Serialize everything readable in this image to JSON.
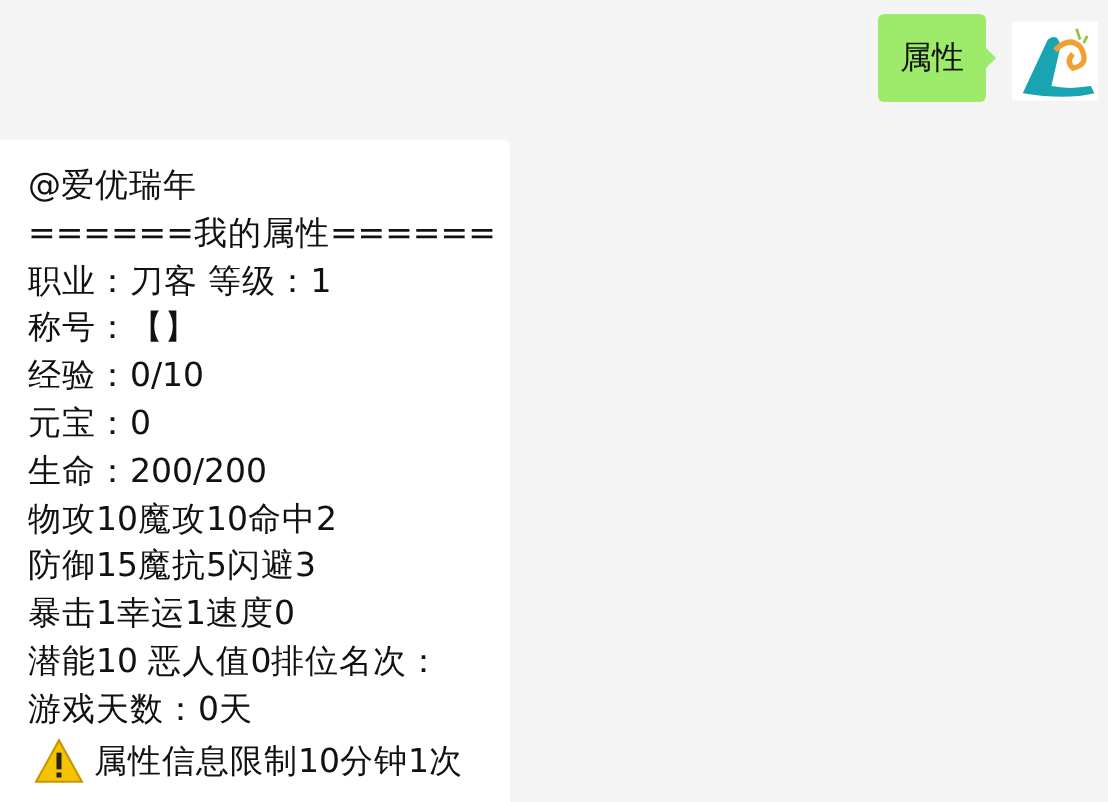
{
  "messages": [
    {
      "kind": "sent",
      "text": "属性"
    },
    {
      "kind": "received",
      "lines": [
        "@爱优瑞年",
        "======我的属性======",
        "职业：刀客  等级：1",
        "称号：【】",
        "经验：0/10",
        "元宝：0",
        "生命：200/200",
        "物攻10魔攻10命中2",
        "防御15魔抗5闪避3",
        "暴击1幸运1速度0",
        "潜能10 恶人值0排位名次：",
        "游戏天数：0天"
      ],
      "warning": "属性信息限制10分钟1次"
    }
  ]
}
